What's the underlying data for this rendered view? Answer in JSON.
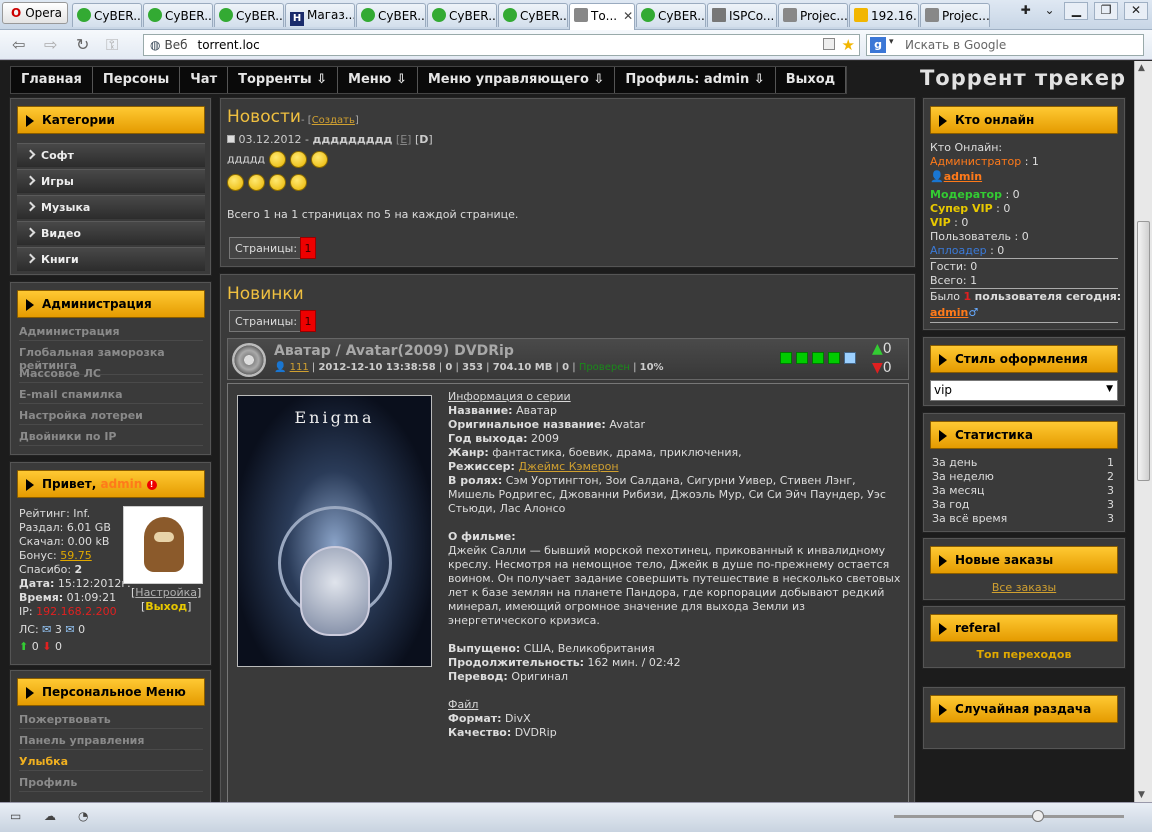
{
  "browser": {
    "opera_label": "Opera",
    "tabs": [
      {
        "label": "CyBER...",
        "icon": "green"
      },
      {
        "label": "CyBER...",
        "icon": "green"
      },
      {
        "label": "CyBER...",
        "icon": "green"
      },
      {
        "label": "Магаз...",
        "icon": "h"
      },
      {
        "label": "CyBER...",
        "icon": "green"
      },
      {
        "label": "CyBER...",
        "icon": "green"
      },
      {
        "label": "CyBER...",
        "icon": "green"
      },
      {
        "label": "То...",
        "icon": "page",
        "active": true
      },
      {
        "label": "CyBER...",
        "icon": "green"
      },
      {
        "label": "ISPCo...",
        "icon": "box"
      },
      {
        "label": "Projec...",
        "icon": "page"
      },
      {
        "label": "192.16...",
        "icon": "pma"
      },
      {
        "label": "Projec...",
        "icon": "page"
      }
    ],
    "url_scheme_label": "Веб",
    "url": "torrent.loc",
    "search_placeholder": "Искать в Google"
  },
  "site": {
    "title": "Торрент трекер",
    "menu": [
      "Главная",
      "Персоны",
      "Чат",
      "Торренты",
      "Меню",
      "Меню управляющего",
      "Профиль: admin",
      "Выход"
    ],
    "menu_dropdown": [
      false,
      false,
      false,
      true,
      true,
      true,
      true,
      false
    ]
  },
  "left": {
    "categories": {
      "header": "Категории",
      "items": [
        "Софт",
        "Игры",
        "Музыка",
        "Видео",
        "Книги"
      ]
    },
    "admin": {
      "header": "Администрация",
      "links": [
        "Администрация",
        "Глобальная заморозка рейтинга",
        "Массовое ЛС",
        "E-mail спамилка",
        "Настройка лотереи",
        "Двойники по IP"
      ]
    },
    "user": {
      "header_prefix": "Привет,",
      "header_name": "admin",
      "rating_label": "Рейтинг:",
      "rating": "Inf.",
      "upload_label": "Раздал:",
      "upload": "6.01 GB",
      "download_label": "Скачал:",
      "download": "0.00 kB",
      "bonus_label": "Бонус:",
      "bonus": "59.75",
      "thanks_label": "Спасибо:",
      "thanks": "2",
      "date_label": "Дата:",
      "date": "15:12:2012г.",
      "time_label": "Время:",
      "time": "01:09:21",
      "ip_label": "IP:",
      "ip": "192.168.2.200",
      "settings_link": "Настройка",
      "logout_link": "Выход",
      "pm_label": "ЛС:",
      "pm_in": "3",
      "pm_out": "0",
      "seeding": "0",
      "leeching": "0"
    },
    "personal": {
      "header": "Персональное Меню",
      "links": [
        "Пожертвовать",
        "Панель управления",
        "Улыбка",
        "Профиль"
      ]
    }
  },
  "news": {
    "title": "Новости",
    "create_link": "Создать",
    "date": "03.12.2012",
    "headline": "ддддддддд",
    "edit": "E",
    "delete": "D",
    "body": "ддддд",
    "pager_text": "Всего 1 на 1 страницах по 5 на каждой странице.",
    "pages_label": "Страницы:",
    "page": "1"
  },
  "new_items": {
    "title": "Новинки",
    "pages_label": "Страницы:",
    "page": "1",
    "torrent": {
      "name": "Аватар / Avatar(2009) DVDRip",
      "author": "111",
      "datetime": "2012-12-10 13:38:58",
      "c1": "0",
      "c2": "353",
      "size": "704.10 MB",
      "c3": "0",
      "status": "Проверен",
      "percent": "10%",
      "seeders": "0",
      "leechers": "0",
      "poster_title": "Enigma",
      "details": {
        "series_info": "Информация о серии",
        "name_label": "Название:",
        "name": "Аватар",
        "orig_label": "Оригинальное название:",
        "orig": "Avatar",
        "year_label": "Год выхода:",
        "year": "2009",
        "genre_label": "Жанр:",
        "genre": "фантастика, боевик, драма, приключения,",
        "director_label": "Режиссер:",
        "director": "Джеймс Кэмерон",
        "cast_label": "В ролях:",
        "cast": "Сэм Уортингтон, Зои Салдана, Сигурни Уивер, Стивен Лэнг, Мишель Родригес, Джованни Рибизи, Джоэль Мур, Си Си Эйч Паундер, Уэс Стьюди, Лас Алонсо",
        "about_label": "О фильме:",
        "about": "Джейк Салли — бывший морской пехотинец, прикованный к инвалидному креслу. Несмотря на немощное тело, Джейк в душе по-прежнему остается воином. Он получает задание совершить путешествие в несколько световых лет к базе землян на планете Пандора, где корпорации добывают редкий минерал, имеющий огромное значение для выхода Земли из энергетического кризиса.",
        "release_label": "Выпущено:",
        "release": "США, Великобритания",
        "duration_label": "Продолжительность:",
        "duration": "162 мин. / 02:42",
        "translation_label": "Перевод:",
        "translation": "Оригинал",
        "file_link": "Файл",
        "format_label": "Формат:",
        "format": "DivX",
        "quality_label": "Качество:",
        "quality": "DVDRip"
      }
    }
  },
  "right": {
    "online": {
      "header": "Кто онлайн",
      "title": "Кто Онлайн:",
      "admin_label": "Администратор",
      "admin_count": "1",
      "admin_user": "admin",
      "mod_label": "Модератор",
      "mod_count": "0",
      "svip_label": "Супер VIP",
      "svip_count": "0",
      "vip_label": "VIP",
      "vip_count": "0",
      "user_label": "Пользователь",
      "user_count": "0",
      "uploader_label": "Аплоадер",
      "uploader_count": "0",
      "guests_label": "Гости:",
      "guests": "0",
      "total_label": "Всего:",
      "total": "1",
      "today_prefix": "Было",
      "today_count": "1",
      "today_suffix": "пользователя сегодня:",
      "today_user": "admin"
    },
    "style": {
      "header": "Стиль оформления",
      "selected": "vip"
    },
    "stats": {
      "header": "Статистика",
      "rows": [
        {
          "label": "За день",
          "value": "1"
        },
        {
          "label": "За неделю",
          "value": "2"
        },
        {
          "label": "За месяц",
          "value": "3"
        },
        {
          "label": "За год",
          "value": "3"
        },
        {
          "label": "За всё время",
          "value": "3"
        }
      ]
    },
    "orders": {
      "header": "Новые заказы",
      "link": "Все заказы"
    },
    "referal": {
      "header": "referal",
      "link": "Топ переходов"
    },
    "random": {
      "header": "Случайная раздача"
    }
  },
  "colors": {
    "accent": "#f5b400",
    "bg": "#3a3a3a",
    "admin": "#ff7a1a",
    "moderator": "#33cc33",
    "vip": "#e8c800",
    "uploader": "#3a7ad8"
  }
}
